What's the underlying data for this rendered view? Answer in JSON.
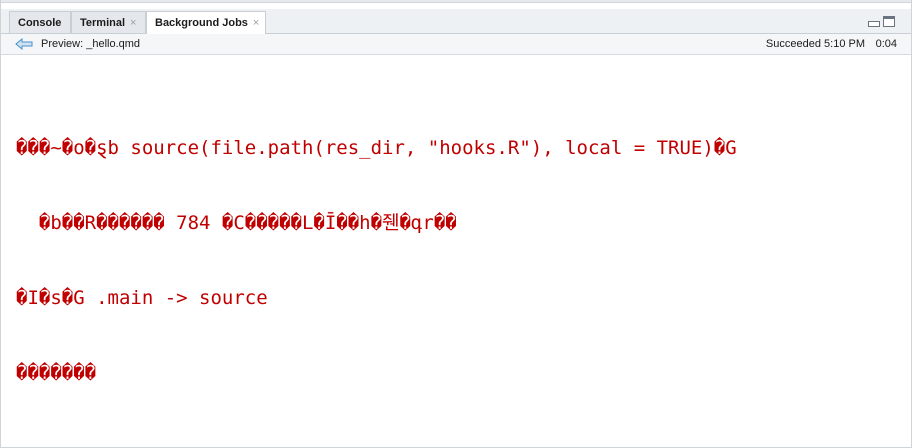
{
  "tabs": [
    {
      "label": "Console",
      "closable": false,
      "active": false
    },
    {
      "label": "Terminal",
      "closable": true,
      "active": false
    },
    {
      "label": "Background Jobs",
      "closable": true,
      "active": true
    }
  ],
  "tab_close_glyph": "×",
  "toolbar": {
    "back_icon": "arrow-left-icon",
    "preview_label": "Preview: _hello.qmd",
    "status": "Succeeded 5:10 PM",
    "elapsed": "0:04"
  },
  "output": {
    "lines": [
      "���~�o�ȿb source(file.path(res_dir, \"hooks.R\"), local = TRUE)�G",
      "  �b��R������ 784 �C�����L�Ī��h�줸�գr��",
      "�I�s�G .main -> source",
      "�������"
    ]
  },
  "colors": {
    "output_text": "#c00000",
    "tabbar_bg": "#eef1f4",
    "toolbar_bg": "#f4f6f8",
    "back_arrow": "#4a90c8"
  }
}
